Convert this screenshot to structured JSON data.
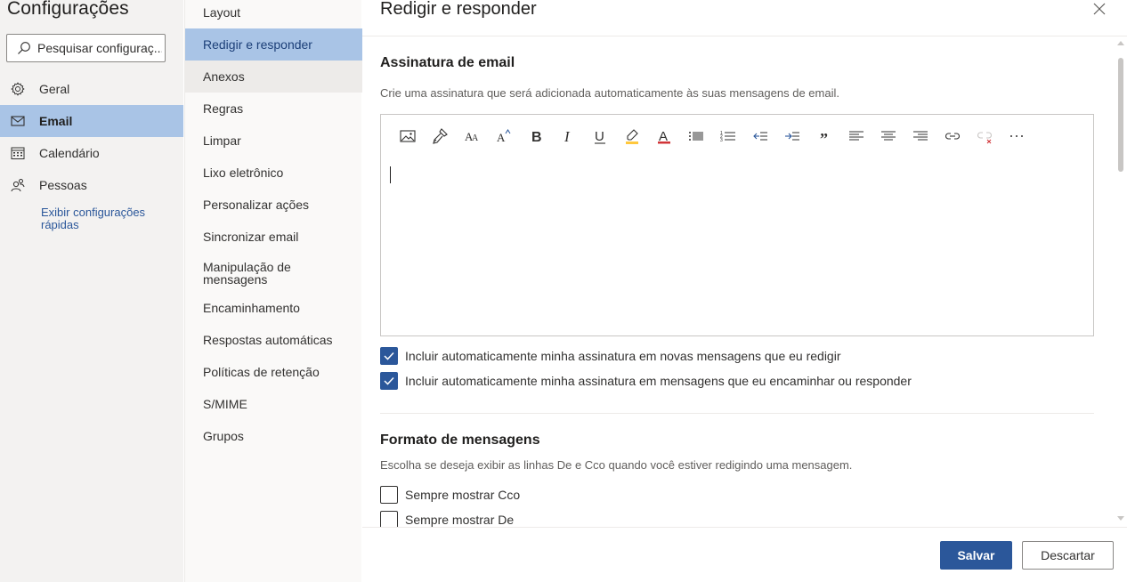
{
  "app": {
    "settings_title": "Configurações",
    "search_placeholder": "Pesquisar configuraç..."
  },
  "categories": [
    {
      "label": "Geral",
      "icon": "gear-icon",
      "active": false
    },
    {
      "label": "Email",
      "icon": "mail-icon",
      "active": true
    },
    {
      "label": "Calendário",
      "icon": "calendar-icon",
      "active": false
    },
    {
      "label": "Pessoas",
      "icon": "people-icon",
      "active": false
    }
  ],
  "quick_settings_link": "Exibir configurações rápidas",
  "subcategories": [
    "Layout",
    "Redigir e responder",
    "Anexos",
    "Regras",
    "Limpar",
    "Lixo eletrônico",
    "Personalizar ações",
    "Sincronizar email",
    "Manipulação de mensagens",
    "Encaminhamento",
    "Respostas automáticas",
    "Políticas de retenção",
    "S/MIME",
    "Grupos"
  ],
  "active_subcategory": "Redigir e responder",
  "pane": {
    "title": "Redigir e responder",
    "signature": {
      "heading": "Assinatura de email",
      "description": "Crie uma assinatura que será adicionada automaticamente às suas mensagens de email.",
      "toolbar_icons": [
        "image-icon",
        "format-painter-icon",
        "font-size-icon",
        "grow-font-icon",
        "bold-icon",
        "italic-icon",
        "underline-icon",
        "highlight-icon",
        "font-color-icon",
        "bullets-icon",
        "numbering-icon",
        "decrease-indent-icon",
        "increase-indent-icon",
        "quote-icon",
        "align-left-icon",
        "align-center-icon",
        "align-right-icon",
        "link-icon",
        "remove-link-icon",
        "more-icon"
      ],
      "checkbox_new": {
        "label": "Incluir automaticamente minha assinatura em novas mensagens que eu redigir",
        "checked": true
      },
      "checkbox_reply": {
        "label": "Incluir automaticamente minha assinatura em mensagens que eu encaminhar ou responder",
        "checked": true
      }
    },
    "format": {
      "heading": "Formato de mensagens",
      "description": "Escolha se deseja exibir as linhas De e Cco quando você estiver redigindo uma mensagem.",
      "checkbox_bcc": {
        "label": "Sempre mostrar Cco",
        "checked": false
      },
      "checkbox_from": {
        "label": "Sempre mostrar De",
        "checked": false
      }
    },
    "save_label": "Salvar",
    "discard_label": "Descartar"
  },
  "colors": {
    "accent": "#2b579a",
    "selected_bg": "#a9c4e6",
    "left_bg": "#f3f2f1",
    "highlight_bar": "#ffc83d",
    "font_color_bar": "#d13438",
    "remove_link_x": "#d13438"
  }
}
